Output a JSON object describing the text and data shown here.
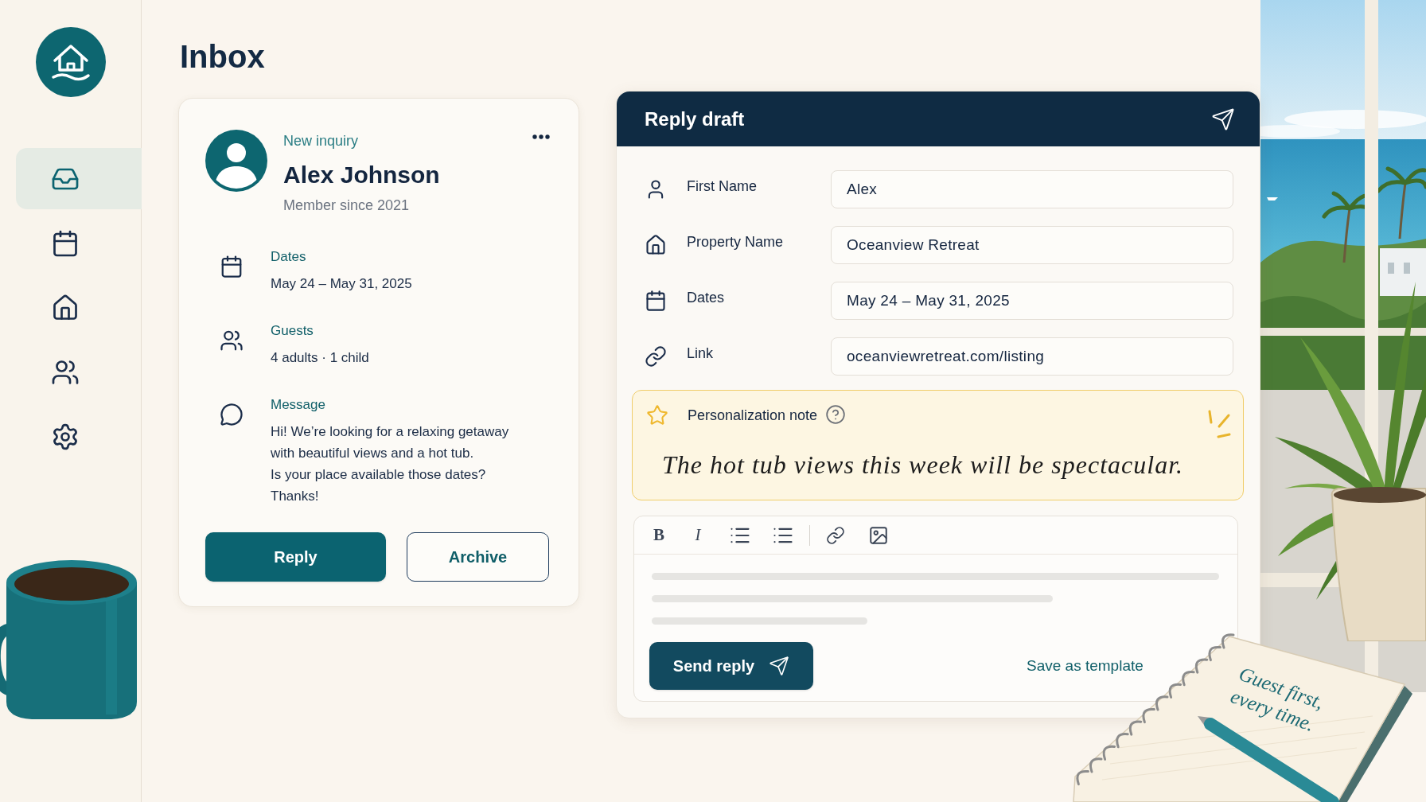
{
  "sidebar": {
    "items": [
      {
        "selected": true
      },
      {
        "selected": false
      },
      {
        "selected": false
      },
      {
        "selected": false
      },
      {
        "selected": false
      }
    ]
  },
  "page": {
    "title": "Inbox"
  },
  "inquiry": {
    "tag": "New inquiry",
    "name": "Alex Johnson",
    "member_since": "Member since 2021",
    "details": [
      {
        "label": "Dates",
        "value": "May 24 – May 31, 2025"
      },
      {
        "label": "Guests",
        "value": "4 adults · 1 child"
      },
      {
        "label": "Message",
        "value": "Hi! We’re looking for a relaxing getaway\nwith beautiful views and a hot tub.\nIs your place available those dates?\nThanks!"
      }
    ],
    "actions": [
      {
        "label": "Reply",
        "kind": "primary"
      },
      {
        "label": "Archive",
        "kind": "outline"
      }
    ]
  },
  "reply_draft": {
    "title": "Reply draft",
    "fields": [
      {
        "label": "First Name",
        "value": "Alex"
      },
      {
        "label": "Property Name",
        "value": "Oceanview Retreat"
      },
      {
        "label": "Dates",
        "value": "May 24 – May 31, 2025"
      },
      {
        "label": "Link",
        "value": "oceanviewretreat.com/listing"
      }
    ],
    "note": {
      "label": "Personalization note",
      "text": "The hot tub views this week will be spectacular."
    },
    "editor": {
      "format_buttons": [
        "B",
        "I"
      ],
      "send_button": "Send reply",
      "template_link": "Save as template"
    }
  },
  "notebook": {
    "note": "Guest first,\nevery time."
  }
}
